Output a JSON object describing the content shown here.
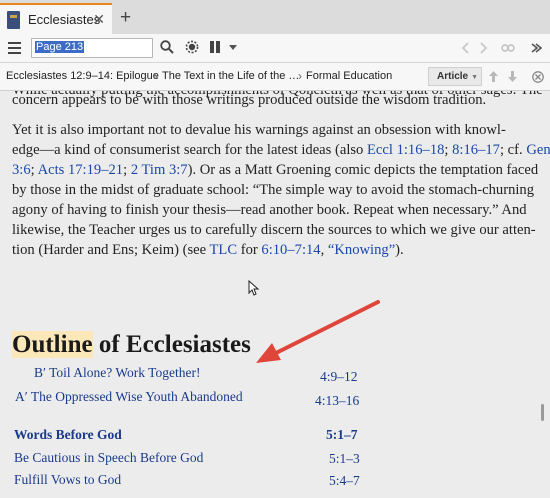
{
  "tab": {
    "title": "Ecclesiastes",
    "close_glyph": "✕",
    "new_tab_glyph": "+"
  },
  "toolbar": {
    "page_field_value": "Page 213",
    "icons": [
      "menu-icon",
      "search-icon",
      "settings-icon",
      "columns-icon",
      "chevron-down-icon",
      "back-arrow-icon",
      "forward-arrow-icon",
      "link-icon",
      "more-icon"
    ]
  },
  "breadcrumb": {
    "items": [
      "Ecclesiastes 12:9–14: Epilogue",
      "The Text in the Life of the …",
      "Formal Education"
    ],
    "separator": "›",
    "view_button": "Article"
  },
  "content": {
    "cut_line": "While actually putting the accomplishments of Qoheleth as well as that of other sages: The",
    "para1": {
      "lines": [
        [
          {
            "t": "concern appears to be with those writings produced outside the wisdom tradition."
          }
        ]
      ]
    },
    "para2": {
      "lines": [
        [
          {
            "t": "    Yet it is also important not to devalue his warnings against an obsession with knowl-"
          }
        ],
        [
          {
            "t": "edge—a kind of consumerist search for the latest ideas (also "
          },
          {
            "t": "Eccl 1:16–18",
            "r": true
          },
          {
            "t": "; "
          },
          {
            "t": "8:16–17",
            "r": true
          },
          {
            "t": "; cf. "
          },
          {
            "t": "Gen",
            "r": true
          }
        ],
        [
          {
            "t": "3:6",
            "r": true
          },
          {
            "t": "; "
          },
          {
            "t": "Acts 17:19–21",
            "r": true
          },
          {
            "t": "; "
          },
          {
            "t": "2 Tim 3:7",
            "r": true
          },
          {
            "t": "). Or as a Matt Groening comic depicts the temptation faced"
          }
        ],
        [
          {
            "t": "by those in the midst of graduate school: “The simple way to avoid the stomach-churning"
          }
        ],
        [
          {
            "t": "agony of having to finish your thesis—read another book. Repeat when necessary.” And"
          }
        ],
        [
          {
            "t": "likewise, the Teacher urges us to carefully discern the sources to which we give our atten-"
          }
        ],
        [
          {
            "t": "tion (Harder and Ens; Keim) (see "
          },
          {
            "t": "TLC",
            "r": true
          },
          {
            "t": " for "
          },
          {
            "t": "6:10–7:14",
            "r": true
          },
          {
            "t": ", "
          },
          {
            "t": "“Knowing”",
            "r": true
          },
          {
            "t": ")."
          }
        ]
      ]
    },
    "outline": {
      "highlighted": "Outline",
      "rest": " of Ecclesiastes"
    },
    "outline_items": [
      {
        "label": "B′  Toil Alone? Work Together!",
        "ref": "4:9–12",
        "bold": false
      },
      {
        "label": "A′  The Oppressed Wise Youth Abandoned",
        "ref": "4:13–16",
        "bold": false
      },
      {
        "label": "Words Before God",
        "ref": "5:1–7",
        "bold": true
      },
      {
        "label": "Be Cautious in Speech Before God",
        "ref": "5:1–3",
        "bold": false
      },
      {
        "label": "Fulfill Vows to God",
        "ref": "5:4–7",
        "bold": false
      }
    ]
  },
  "colors": {
    "accent_tab": "#e8871e",
    "link": "#1a47a8",
    "highlight": "#fce7b8",
    "arrow": "#e0453a"
  }
}
